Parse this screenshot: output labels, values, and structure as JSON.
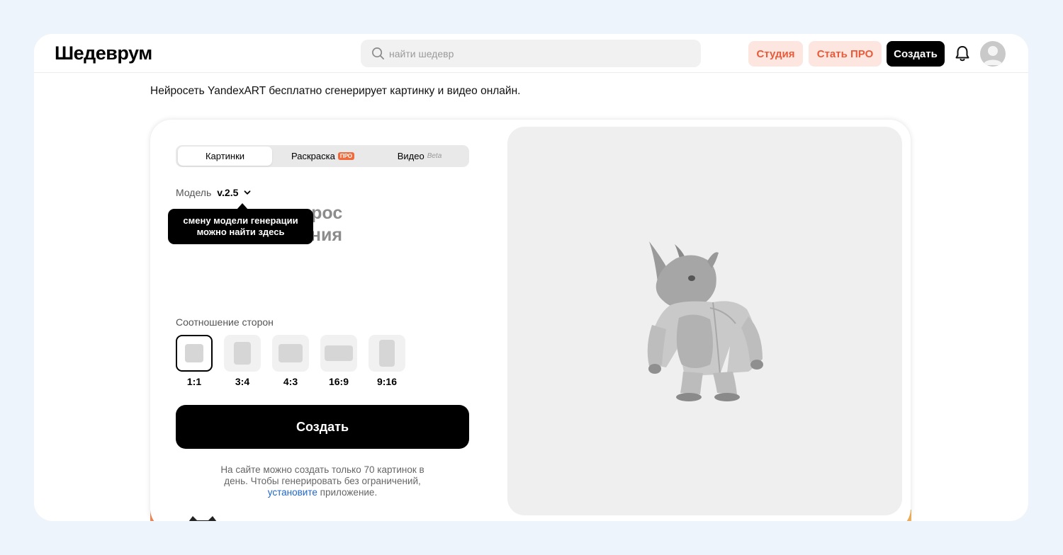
{
  "header": {
    "logo": "Шедеврум",
    "search_placeholder": "найти шедевр",
    "studio": "Студия",
    "pro": "Стать ПРО",
    "create": "Создать"
  },
  "subtitle": "Нейросеть YandexART бесплатно сгенерирует картинку и видео онлайн.",
  "card": {
    "tabs": [
      {
        "label": "Картинки"
      },
      {
        "label": "Раскраска",
        "badge": "ПРО"
      },
      {
        "label": "Видео",
        "badge": "Beta"
      }
    ],
    "model_label": "Модель",
    "model_value": "v.2.5",
    "prompt_ghost_line1": "прос",
    "prompt_ghost_line2": "ения",
    "tooltip": {
      "line1": "смену модели генерации",
      "line2": "можно найти здесь"
    },
    "ratio_label": "Соотношение сторон",
    "ratios": [
      "1:1",
      "3:4",
      "4:3",
      "16:9",
      "9:16"
    ],
    "selected_ratio": "1:1",
    "create_button": "Создать",
    "limit_note_1": "На сайте можно создать только 70 картинок в",
    "limit_note_2": "день. Чтобы генерировать без ограничений,",
    "limit_link": "установите",
    "limit_note_3": "приложение."
  },
  "colors": {
    "accent": "#e85b3a",
    "accent_bg": "#fde6e0",
    "primary": "#000000",
    "link": "#1f66c9"
  },
  "icons": [
    "search-icon",
    "bell-icon",
    "avatar",
    "chevron-down-icon"
  ]
}
